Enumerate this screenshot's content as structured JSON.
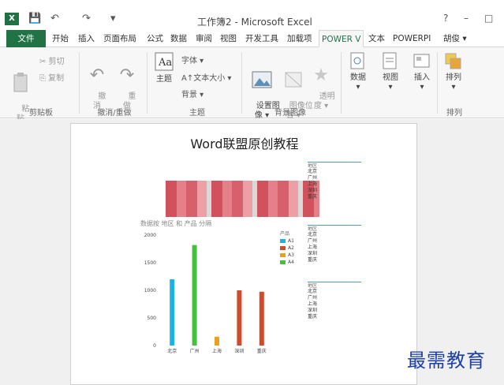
{
  "window": {
    "title": "工作簿2 - Microsoft Excel",
    "app_icon": "X",
    "help": "?",
    "min": "–",
    "max": "□"
  },
  "qat": {
    "save": "💾",
    "undo": "↶",
    "redo": "↷",
    "customize": "▾"
  },
  "tabs": {
    "file": "文件",
    "items": [
      "开始",
      "插入",
      "页面布局",
      "公式",
      "数据",
      "审阅",
      "视图",
      "开发工具",
      "加载项",
      "POWER V",
      "文本",
      "POWERPI"
    ],
    "user": "胡俊 ▾"
  },
  "ribbon": {
    "clipboard": {
      "paste": "粘\n贴",
      "cut": "✂ 剪切",
      "copy": "⎘ 复制",
      "group": "剪贴板"
    },
    "undo_group": {
      "undo": "撤\n消",
      "redo": "重\n做",
      "group": "撤消/重做"
    },
    "theme": {
      "theme_btn": "主题",
      "font": "字体 ▾",
      "font_size": "A↑文本大小 ▾",
      "background": "背景 ▾",
      "group": "主题"
    },
    "bg_image": {
      "set_image": "设置图\n像 ▾",
      "image_pos": "图像位\n置 ▾",
      "transparency": "透明\n度 ▾",
      "group": "背景图像"
    },
    "data": "数据",
    "view": "视图",
    "insert": "插入",
    "arrange": "排列",
    "arrange_group": "排列"
  },
  "document": {
    "title": "Word联盟原创教程",
    "chart_subtitle": "数据按 地区 和 产品 分隔",
    "legend_title": "产品",
    "slicer_title": "地区",
    "slicers": [
      {
        "items": [
          "北京",
          "广州",
          "上海",
          "深圳",
          "重庆"
        ]
      },
      {
        "items": [
          "北京",
          "广州",
          "上海",
          "深圳",
          "重庆"
        ]
      },
      {
        "items": [
          "北京",
          "广州",
          "上海",
          "深圳",
          "重庆"
        ]
      }
    ]
  },
  "chart_data": {
    "type": "bar",
    "categories": [
      "北京",
      "广州",
      "上海",
      "深圳",
      "重庆"
    ],
    "series": [
      {
        "name": "A1",
        "color": "#1fb1e3",
        "values": [
          1200,
          0,
          0,
          0,
          0
        ]
      },
      {
        "name": "A2",
        "color": "#d04a2b",
        "values": [
          0,
          0,
          0,
          1000,
          975
        ]
      },
      {
        "name": "A3",
        "color": "#e8a21e",
        "values": [
          0,
          0,
          160,
          0,
          0
        ]
      },
      {
        "name": "A4",
        "color": "#45c13c",
        "values": [
          0,
          1820,
          0,
          0,
          0
        ]
      }
    ],
    "ylim": [
      0,
      2000
    ],
    "yticks": [
      0,
      500,
      1000,
      1500,
      2000
    ],
    "legend": "right"
  },
  "watermark": "最需教育"
}
